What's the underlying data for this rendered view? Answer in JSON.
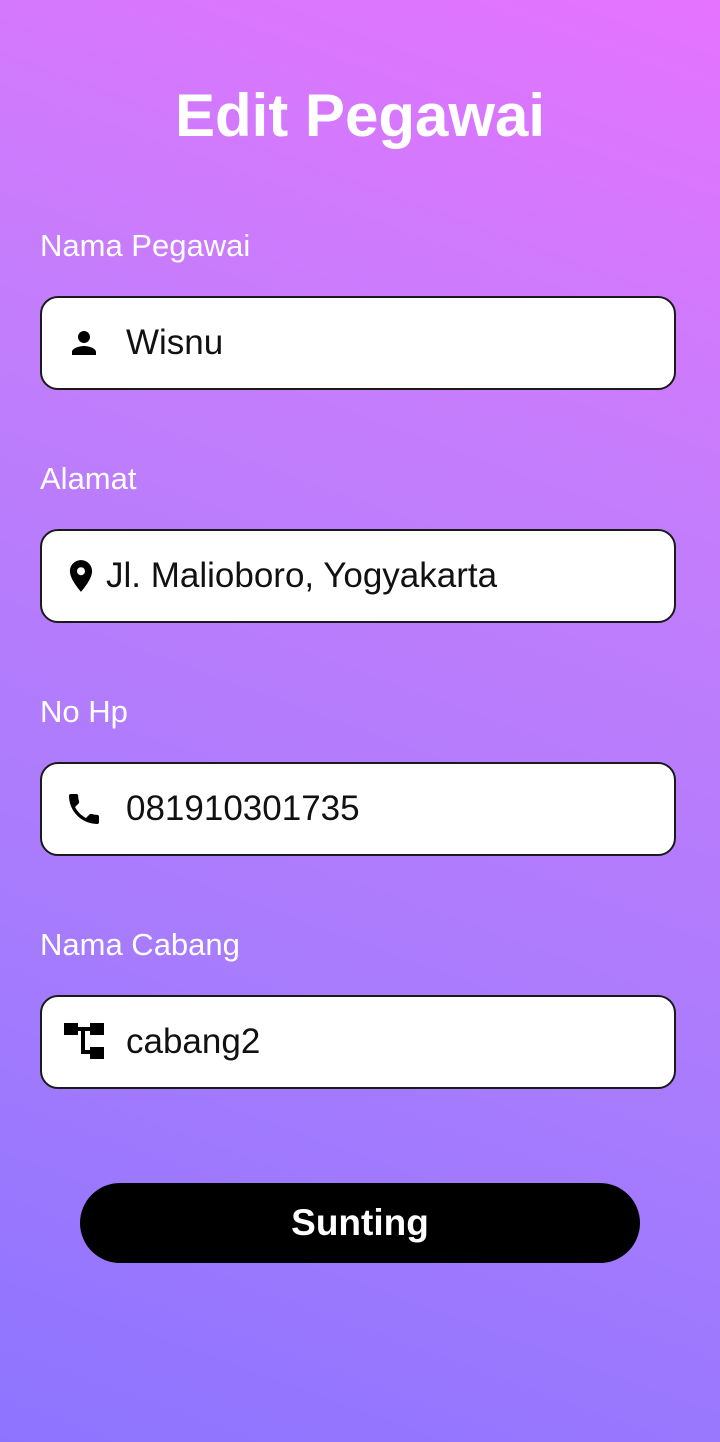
{
  "page": {
    "title": "Edit Pegawai"
  },
  "form": {
    "nama_pegawai": {
      "label": "Nama Pegawai",
      "value": "Wisnu",
      "icon": "person-icon"
    },
    "alamat": {
      "label": "Alamat",
      "value": "Jl. Malioboro, Yogyakarta",
      "icon": "location-pin-icon"
    },
    "no_hp": {
      "label": "No Hp",
      "value": "081910301735",
      "icon": "phone-icon"
    },
    "nama_cabang": {
      "label": "Nama Cabang",
      "value": "cabang2",
      "icon": "branch-tree-icon"
    },
    "submit_label": "Sunting"
  },
  "colors": {
    "gradient_top": "#e573ff",
    "gradient_bottom": "#8d74ff",
    "field_bg": "#ffffff",
    "button_bg": "#000000",
    "text_light": "#ffffff"
  }
}
